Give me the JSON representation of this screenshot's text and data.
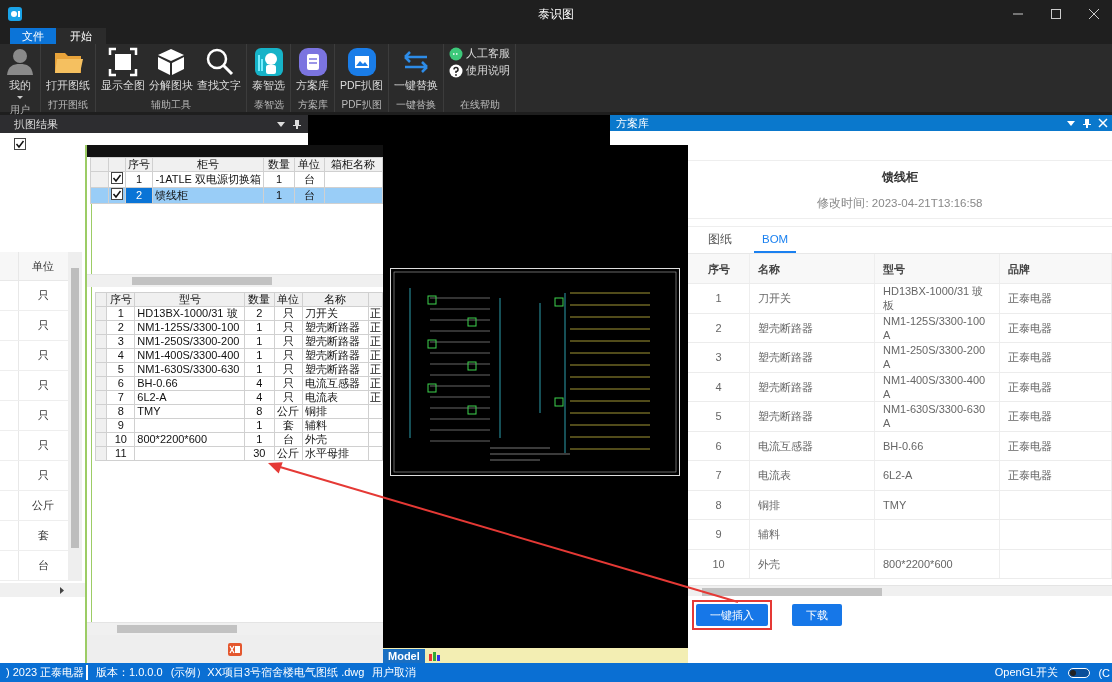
{
  "window": {
    "title": "泰识图"
  },
  "menu_tabs": [
    {
      "label": "文件",
      "kind": "app-menu",
      "selected": false
    },
    {
      "label": "开始",
      "kind": "tab",
      "selected": true
    }
  ],
  "ribbon": {
    "groups": [
      {
        "label": "用户",
        "buttons": [
          {
            "label": "我的",
            "kind": "large",
            "dropdown": true
          }
        ]
      },
      {
        "label": "打开图纸",
        "buttons": [
          {
            "label": "打开图纸",
            "kind": "large",
            "dropdown": false
          }
        ]
      },
      {
        "label": "辅助工具",
        "buttons": [
          {
            "label": "显示全图",
            "kind": "large",
            "dropdown": false
          },
          {
            "label": "分解图块",
            "kind": "large",
            "dropdown": false
          },
          {
            "label": "查找文字",
            "kind": "large",
            "dropdown": false
          }
        ]
      },
      {
        "label": "泰智选",
        "buttons": [
          {
            "label": "泰智选",
            "kind": "large",
            "dropdown": false
          }
        ]
      },
      {
        "label": "方案库",
        "buttons": [
          {
            "label": "方案库",
            "kind": "large",
            "dropdown": false
          }
        ]
      },
      {
        "label": "PDF扒图",
        "buttons": [
          {
            "label": "PDF扒图",
            "kind": "large",
            "dropdown": false
          }
        ]
      },
      {
        "label": "一键替换",
        "buttons": [
          {
            "label": "一键替换",
            "kind": "large",
            "dropdown": false
          }
        ]
      },
      {
        "label": "在线帮助",
        "buttons": [
          {
            "label": "人工客服",
            "kind": "small"
          },
          {
            "label": "使用说明",
            "kind": "small"
          }
        ]
      }
    ]
  },
  "left_panel": {
    "title": "扒图结果",
    "checkbox": {
      "checked": true
    },
    "grid": {
      "columns": [
        "单位"
      ],
      "rows": [
        "只",
        "只",
        "只",
        "只",
        "只",
        "只",
        "只",
        "公斤",
        "套",
        "台"
      ]
    }
  },
  "dialog": {
    "cabinet_table": {
      "columns": [
        "序号",
        "柜号",
        "数量",
        "单位",
        "箱柜名称"
      ],
      "rows": [
        {
          "checked": true,
          "selected": false,
          "no": "1",
          "cabinet": "-1ATLE 双电源切换箱",
          "qty": "1",
          "unit": "台"
        },
        {
          "checked": true,
          "selected": true,
          "no": "2",
          "cabinet": "馈线柜",
          "qty": "1",
          "unit": "台"
        }
      ]
    },
    "bom_table": {
      "columns": [
        "序号",
        "型号",
        "数量",
        "单位",
        "名称"
      ],
      "rows": [
        {
          "no": "1",
          "model": "HD13BX-1000/31 玻",
          "qty": "2",
          "unit": "只",
          "name": "刀开关",
          "column_6": "正"
        },
        {
          "no": "2",
          "model": "NM1-125S/3300-100",
          "qty": "1",
          "unit": "只",
          "name": "塑壳断路器",
          "column_6": "正"
        },
        {
          "no": "3",
          "model": "NM1-250S/3300-200",
          "qty": "1",
          "unit": "只",
          "name": "塑壳断路器",
          "column_6": "正"
        },
        {
          "no": "4",
          "model": "NM1-400S/3300-400",
          "qty": "1",
          "unit": "只",
          "name": "塑壳断路器",
          "column_6": "正"
        },
        {
          "no": "5",
          "model": "NM1-630S/3300-630",
          "qty": "1",
          "unit": "只",
          "name": "塑壳断路器",
          "column_6": "正"
        },
        {
          "no": "6",
          "model": "BH-0.66",
          "qty": "4",
          "unit": "只",
          "name": "电流互感器",
          "column_6": "正"
        },
        {
          "no": "7",
          "model": "6L2-A",
          "qty": "4",
          "unit": "只",
          "name": "电流表",
          "column_6": "正"
        },
        {
          "no": "8",
          "model": "TMY",
          "qty": "8",
          "unit": "公斤",
          "name": "铜排"
        },
        {
          "no": "9",
          "qty": "1",
          "unit": "套",
          "name": "辅料"
        },
        {
          "no": "10",
          "model": "800*2200*600",
          "qty": "1",
          "unit": "台",
          "name": "外壳"
        },
        {
          "no": "11",
          "qty": "30",
          "unit": "公斤",
          "name": "水平母排"
        }
      ]
    },
    "cad_view": {
      "layout_tab": "Model"
    }
  },
  "scheme_panel": {
    "title": "方案库",
    "heading": "馈线柜",
    "modified": "修改时间: 2023-04-21T13:16:58",
    "tabs": [
      {
        "label": "图纸",
        "selected": false
      },
      {
        "label": "BOM",
        "selected": true
      }
    ],
    "table": {
      "columns": [
        "序号",
        "名称",
        "型号",
        "品牌"
      ],
      "rows": [
        {
          "no": "1",
          "name": "刀开关",
          "model": "HD13BX-1000/31 玻板",
          "brand": "正泰电器"
        },
        {
          "no": "2",
          "name": "塑壳断路器",
          "model": "NM1-125S/3300-100A",
          "brand": "正泰电器"
        },
        {
          "no": "3",
          "name": "塑壳断路器",
          "model": "NM1-250S/3300-200A",
          "brand": "正泰电器"
        },
        {
          "no": "4",
          "name": "塑壳断路器",
          "model": "NM1-400S/3300-400A",
          "brand": "正泰电器"
        },
        {
          "no": "5",
          "name": "塑壳断路器",
          "model": "NM1-630S/3300-630A",
          "brand": "正泰电器"
        },
        {
          "no": "6",
          "name": "电流互感器",
          "model": "BH-0.66",
          "brand": "正泰电器"
        },
        {
          "no": "7",
          "name": "电流表",
          "model": "6L2-A",
          "brand": "正泰电器"
        },
        {
          "no": "8",
          "name": "铜排",
          "model": "TMY"
        },
        {
          "no": "9",
          "name": "辅料"
        },
        {
          "no": "10",
          "name": "外壳",
          "model": "800*2200*600"
        }
      ]
    },
    "buttons": [
      {
        "label": "一键插入",
        "highlighted": true
      },
      {
        "label": "下载",
        "highlighted": false
      }
    ]
  },
  "status_bar": {
    "copyright": ") 2023 正泰电器",
    "items": [
      "版本：1.0.0.0",
      "(示例）XX项目3号宿舍楼电气图纸 .dwg",
      "用户取消"
    ],
    "opengl": {
      "label": "OpenGL开关",
      "on": false
    },
    "trailing": "(C"
  }
}
